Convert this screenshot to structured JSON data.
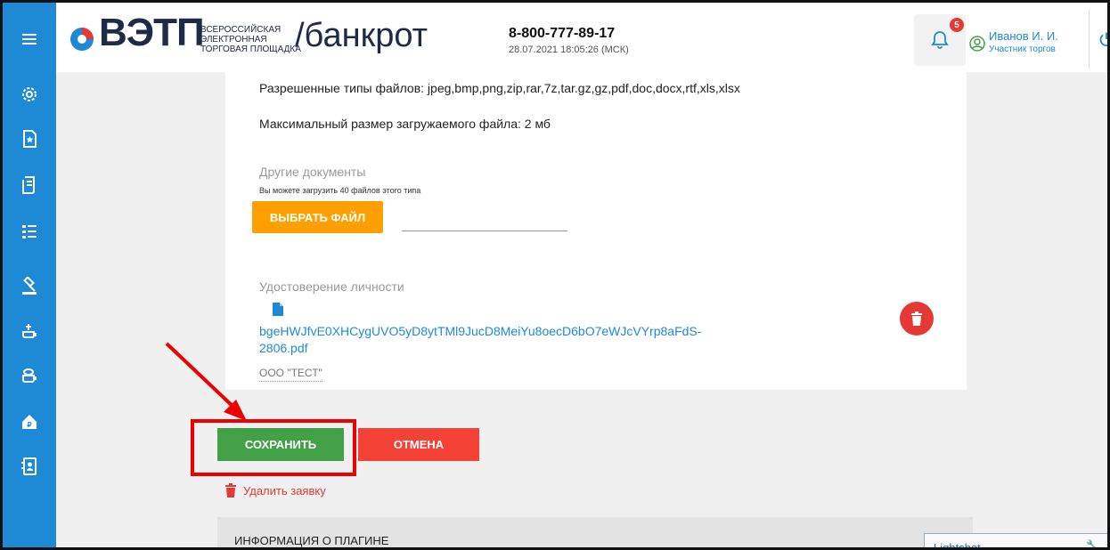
{
  "header": {
    "brand": "ВЭТП",
    "brand_sub_1": "Всероссийская",
    "brand_sub_2": "электронная",
    "brand_sub_3": "торговая площадка",
    "section": "/банкрот",
    "phone": "8-800-777-89-17",
    "datetime": "28.07.2021 18:05:26 (МСК)",
    "notifications_count": "5",
    "user_name": "Иванов И. И.",
    "user_role": "Участник торгов"
  },
  "sidebar": {
    "items": [
      "menu-icon",
      "settings-icon",
      "document-star-icon",
      "contract-icon",
      "list-icon",
      "auction-icon",
      "lot-icon",
      "lot-2-icon",
      "house-icon",
      "contacts-icon"
    ]
  },
  "form": {
    "allowed_types": "Разрешенные типы файлов: jpeg,bmp,png,zip,rar,7z,tar.gz,gz,pdf,doc,docx,rtf,xls,xlsx",
    "max_size": "Максимальный размер загружаемого файла: 2 мб",
    "other_docs_label": "Другие документы",
    "other_docs_hint": "Вы можете загрузить 40 файлов этого типа",
    "choose_file_label": "ВЫБРАТЬ ФАЙЛ",
    "identity_label": "Удостоверение личности",
    "file_name": "bgeHWJfvE0XHCygUVO5yD8ytTMl9JucD8MeiYu8oecD6bO7eWJcVYrp8aFdS-2806.pdf",
    "file_name_line1": "bgeHWJfvE0XHCygUVO5yD8ytTMl9JucD8MeiYu8oecD6bO7eWJcVYrp8aFdS-",
    "file_name_line2": "2806.pdf",
    "org_name": "ООО \"ТЕСТ\""
  },
  "actions": {
    "save_label": "СОХРАНИТЬ",
    "cancel_label": "ОТМЕНА",
    "delete_application_label": "Удалить заявку"
  },
  "plugin": {
    "title": "ИНФОРМАЦИЯ О ПЛАГИНЕ"
  },
  "lightshot": {
    "label": "Lightshot"
  },
  "colors": {
    "sidebar": "#1e8ad6",
    "save": "#43a047",
    "cancel": "#f44336",
    "choose": "#ffa000",
    "highlight": "#e00000"
  }
}
